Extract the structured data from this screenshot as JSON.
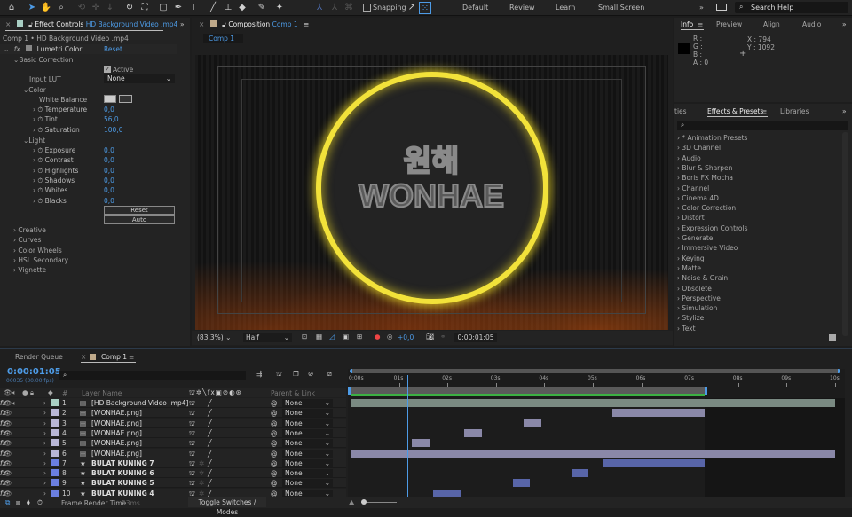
{
  "toolbar": {
    "snapping": "Snapping",
    "workspaces": [
      "Default",
      "Review",
      "Learn",
      "Small Screen"
    ],
    "search_placeholder": "Search Help"
  },
  "effect_controls": {
    "tab_label": "Effect Controls",
    "tab_file": "HD Background Video .mp4",
    "layer_path": "Comp 1 • HD Background Video .mp4",
    "effect_name": "Lumetri Color",
    "reset": "Reset",
    "basic_correction": "Basic Correction",
    "active": "Active",
    "input_lut_label": "Input LUT",
    "input_lut_value": "None",
    "color_section": "Color",
    "white_balance": "White Balance",
    "color_props": [
      {
        "label": "Temperature",
        "value": "0,0"
      },
      {
        "label": "Tint",
        "value": "56,0"
      },
      {
        "label": "Saturation",
        "value": "100,0"
      }
    ],
    "light_section": "Light",
    "light_props": [
      {
        "label": "Exposure",
        "value": "0,0"
      },
      {
        "label": "Contrast",
        "value": "0,0"
      },
      {
        "label": "Highlights",
        "value": "0,0"
      },
      {
        "label": "Shadows",
        "value": "0,0"
      },
      {
        "label": "Whites",
        "value": "0,0"
      },
      {
        "label": "Blacks",
        "value": "0,0"
      }
    ],
    "reset_btn": "Reset",
    "auto_btn": "Auto",
    "sections": [
      "Creative",
      "Curves",
      "Color Wheels",
      "HSL Secondary",
      "Vignette"
    ]
  },
  "composition": {
    "tab_label": "Composition",
    "tab_comp": "Comp 1",
    "breadcrumb": "Comp 1",
    "logo_korean": "원해",
    "logo_text": "WONHAE",
    "zoom": "(83,3%)",
    "resolution": "Half",
    "exposure": "+0,0",
    "timecode": "0:00:01:05"
  },
  "info": {
    "tabs": [
      "Info",
      "Preview",
      "Align",
      "Audio"
    ],
    "r": "R :",
    "g": "G :",
    "b": "B :",
    "a": "A :  0",
    "x": "X : 794",
    "y": "Y : 1092"
  },
  "effects_presets": {
    "tabs": [
      "ties",
      "Effects & Presets",
      "Libraries"
    ],
    "items": [
      "* Animation Presets",
      "3D Channel",
      "Audio",
      "Blur & Sharpen",
      "Boris FX Mocha",
      "Channel",
      "Cinema 4D",
      "Color Correction",
      "Distort",
      "Expression Controls",
      "Generate",
      "Immersive Video",
      "Keying",
      "Matte",
      "Noise & Grain",
      "Obsolete",
      "Perspective",
      "Simulation",
      "Stylize",
      "Text"
    ]
  },
  "timeline": {
    "tabs": [
      "Render Queue",
      "Comp 1"
    ],
    "timecode": "0:00:01:05",
    "frame_info": "00035 (30.00 fps)",
    "col_num": "#",
    "col_name": "Layer Name",
    "col_parent": "Parent & Link",
    "ruler": [
      "0:00s",
      "01s",
      "02s",
      "03s",
      "04s",
      "05s",
      "06s",
      "07s",
      "08s",
      "09s",
      "10s"
    ],
    "duration_s": 10,
    "playhead_s": 1.17,
    "work_area_end_s": 7.3,
    "layers": [
      {
        "num": "1",
        "name": "[HD Background Video .mp4]",
        "type": "footage",
        "label": "#a9cfc4",
        "parent": "None",
        "in": 0,
        "out": 10,
        "bar": "#7a8a82"
      },
      {
        "num": "2",
        "name": "[WONHAE.png]",
        "type": "footage",
        "label": "#b8b6d6",
        "parent": "None",
        "in": 5.4,
        "out": 7.3,
        "bar": "#8a88a8"
      },
      {
        "num": "3",
        "name": "[WONHAE.png]",
        "type": "footage",
        "label": "#b8b6d6",
        "parent": "None",
        "in": 3.57,
        "out": 3.93,
        "bar": "#8a88a8"
      },
      {
        "num": "4",
        "name": "[WONHAE.png]",
        "type": "footage",
        "label": "#b8b6d6",
        "parent": "None",
        "in": 2.35,
        "out": 2.71,
        "bar": "#8a88a8"
      },
      {
        "num": "5",
        "name": "[WONHAE.png]",
        "type": "footage",
        "label": "#b8b6d6",
        "parent": "None",
        "in": 1.27,
        "out": 1.63,
        "bar": "#8a88a8"
      },
      {
        "num": "6",
        "name": "[WONHAE.png]",
        "type": "footage",
        "label": "#b8b6d6",
        "parent": "None",
        "in": 0,
        "out": 10,
        "bar": "#8a88a8"
      },
      {
        "num": "7",
        "name": "BULAT KUNING 7",
        "type": "shape",
        "label": "#6b7fe0",
        "parent": "None",
        "in": 5.2,
        "out": 7.3,
        "bar": "#5865a8"
      },
      {
        "num": "8",
        "name": "BULAT KUNING 6",
        "type": "shape",
        "label": "#6b7fe0",
        "parent": "None",
        "in": 4.56,
        "out": 4.89,
        "bar": "#5865a8"
      },
      {
        "num": "9",
        "name": "BULAT KUNING 5",
        "type": "shape",
        "label": "#6b7fe0",
        "parent": "None",
        "in": 3.35,
        "out": 3.7,
        "bar": "#5865a8"
      },
      {
        "num": "10",
        "name": "BULAT KUNING 4",
        "type": "shape",
        "label": "#6b7fe0",
        "parent": "None",
        "in": 1.7,
        "out": 2.29,
        "bar": "#5865a8"
      }
    ],
    "frame_render_label": "Frame Render Time",
    "frame_render_value": "53ms",
    "toggle_label": "Toggle Switches / Modes"
  }
}
